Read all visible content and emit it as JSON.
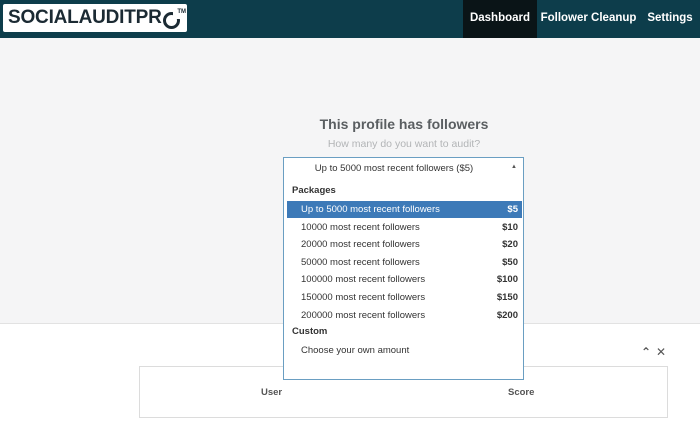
{
  "app": {
    "logo_text": "SOCIALAUDITPR",
    "logo_tm": "TM"
  },
  "nav": {
    "items": [
      {
        "label": "Dashboard",
        "active": true
      },
      {
        "label": "Follower Cleanup",
        "active": false
      },
      {
        "label": "Settings",
        "active": false
      }
    ]
  },
  "main": {
    "heading": "This profile has followers",
    "subheading": "How many do you want to audit?"
  },
  "select": {
    "value": "Up to 5000 most recent followers ($5)",
    "groups": [
      {
        "label": "Packages",
        "options": [
          {
            "label": "Up to 5000 most recent followers",
            "price": "$5",
            "selected": true
          },
          {
            "label": "10000 most recent followers",
            "price": "$10",
            "selected": false
          },
          {
            "label": "20000 most recent followers",
            "price": "$20",
            "selected": false
          },
          {
            "label": "50000 most recent followers",
            "price": "$50",
            "selected": false
          },
          {
            "label": "100000 most recent followers",
            "price": "$100",
            "selected": false
          },
          {
            "label": "150000 most recent followers",
            "price": "$150",
            "selected": false
          },
          {
            "label": "200000 most recent followers",
            "price": "$200",
            "selected": false
          }
        ]
      },
      {
        "label": "Custom",
        "options": [
          {
            "label": "Choose your own amount",
            "price": "",
            "selected": false
          }
        ]
      }
    ]
  },
  "table": {
    "columns": [
      "User",
      "Score"
    ]
  },
  "icons": {
    "collapse": "chevron-up-icon",
    "close": "close-icon",
    "select_arrow": "caret-up-icon"
  },
  "colors": {
    "navbar": "#0d3d4b",
    "nav_active": "#0a1417",
    "selected_option": "#3d7ab8",
    "select_border": "#6a9ec2"
  }
}
